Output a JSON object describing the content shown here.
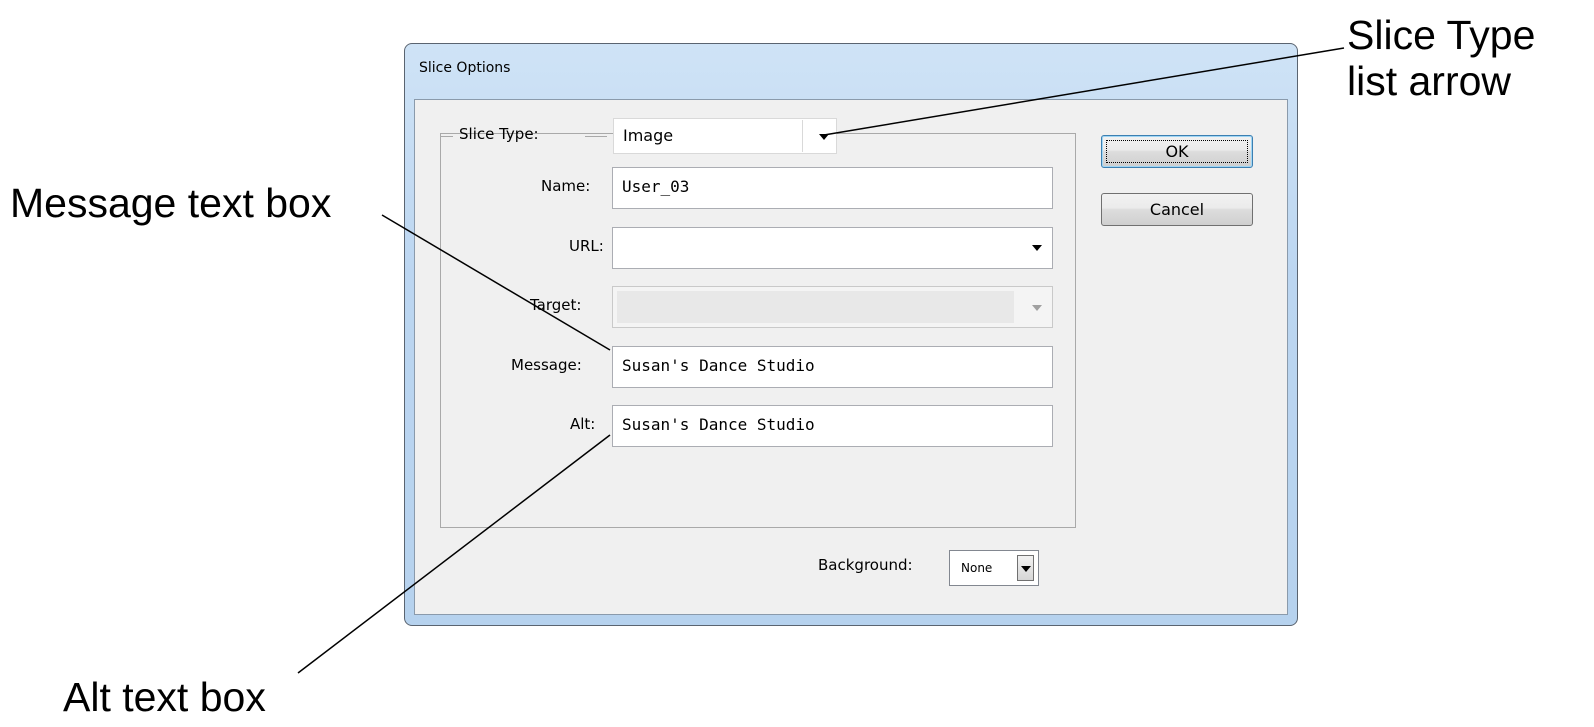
{
  "callouts": {
    "slice_type_line1": "Slice Type",
    "slice_type_line2": "list arrow",
    "message": "Message text box",
    "alt": "Alt text box"
  },
  "dialog": {
    "title": "Slice Options",
    "slice_type": {
      "label": "Slice Type:",
      "value": "Image"
    },
    "name": {
      "label": "Name:",
      "value": "User_03"
    },
    "url": {
      "label": "URL:",
      "value": ""
    },
    "target": {
      "label": "Target:",
      "value": ""
    },
    "message": {
      "label": "Message:",
      "value": "Susan's Dance Studio"
    },
    "alt": {
      "label": "Alt:",
      "value": "Susan's Dance Studio"
    },
    "background": {
      "label": "Background:",
      "value": "None"
    },
    "ok_label": "OK",
    "cancel_label": "Cancel"
  },
  "icons": {
    "dropdown": "chevron-down-icon"
  },
  "colors": {
    "title_bar": "#bcd6f1",
    "client": "#f0f0f0",
    "default_button_border": "#3c7fb1"
  }
}
